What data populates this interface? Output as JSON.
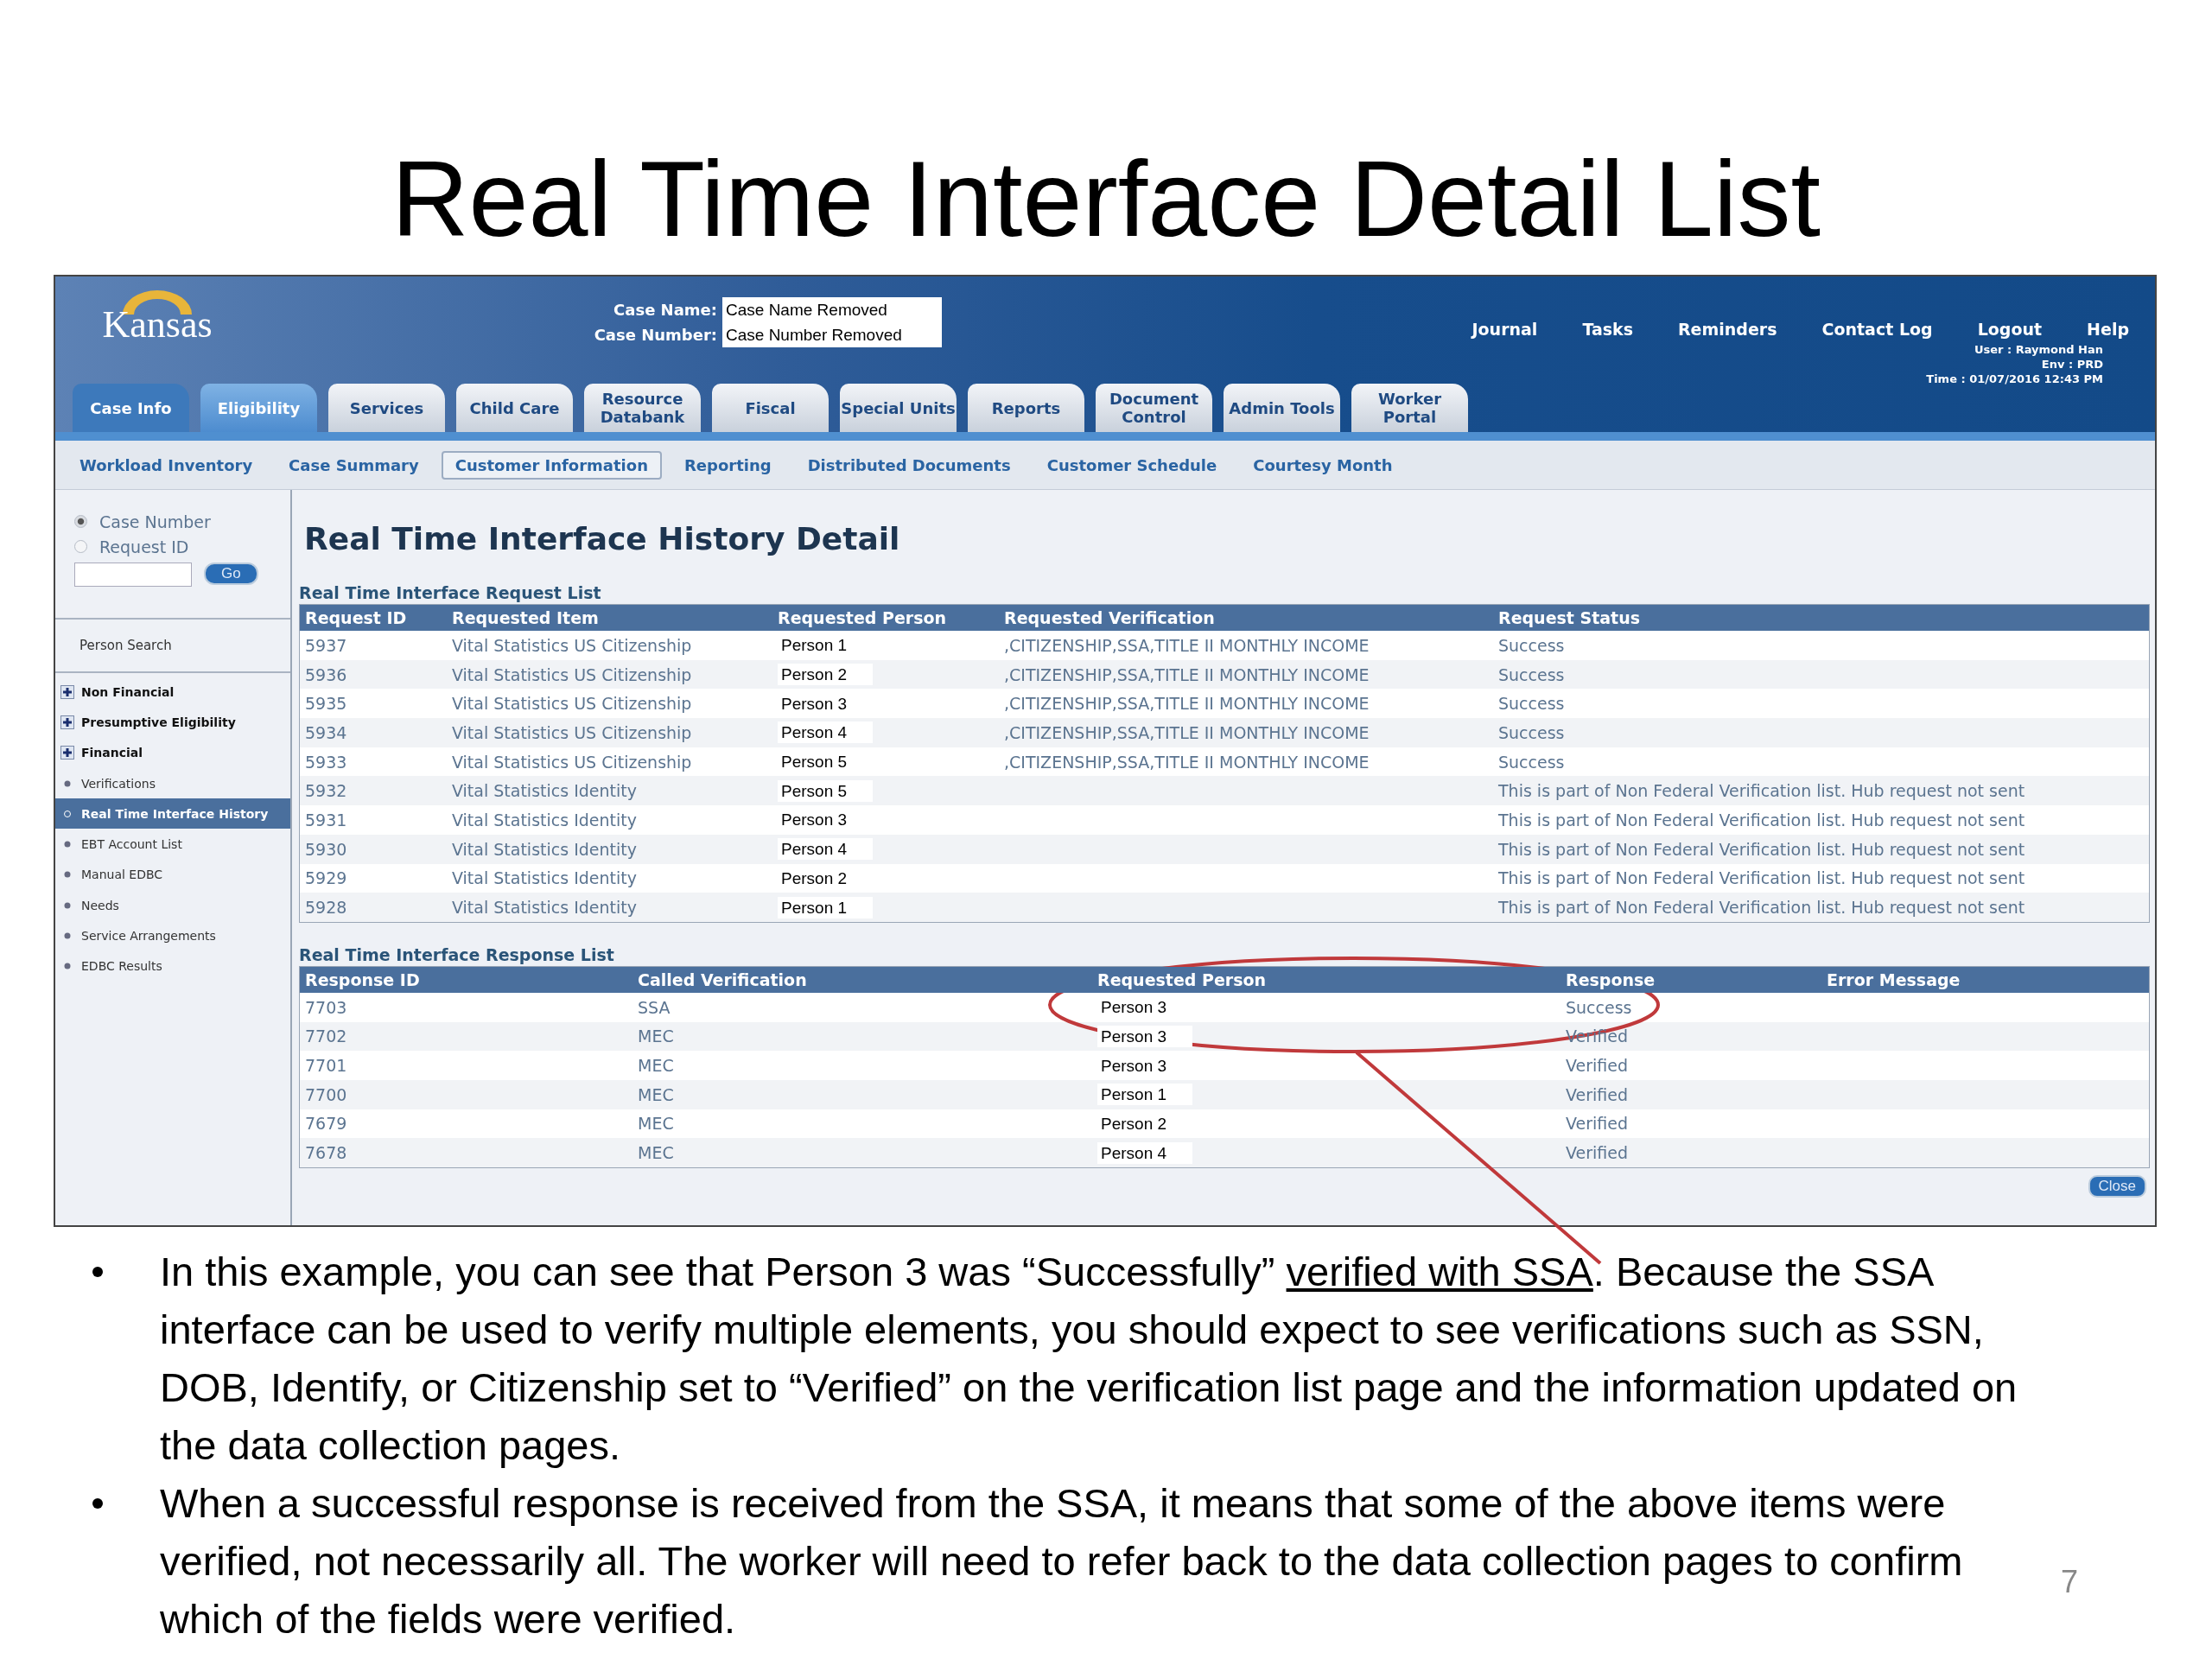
{
  "slide_title": "Real Time Interface Detail List",
  "app": {
    "logo": "Kansas",
    "case_fields": [
      {
        "label": "Case Name:",
        "value": "Case Name Removed"
      },
      {
        "label": "Case Number:",
        "value": "Case Number Removed"
      }
    ],
    "top_links": [
      "Journal",
      "Tasks",
      "Reminders",
      "Contact Log",
      "Logout",
      "Help"
    ],
    "user_info": [
      "User : Raymond Han",
      "Env : PRD",
      "Time : 01/07/2016 12:43 PM"
    ],
    "tabs": [
      {
        "label": "Case Info",
        "selected": true
      },
      {
        "label": "Eligibility",
        "selected": true
      },
      {
        "label": "Services",
        "selected": false
      },
      {
        "label": "Child Care",
        "selected": false
      },
      {
        "label": "Resource Databank",
        "selected": false
      },
      {
        "label": "Fiscal",
        "selected": false
      },
      {
        "label": "Special Units",
        "selected": false
      },
      {
        "label": "Reports",
        "selected": false
      },
      {
        "label": "Document Control",
        "selected": false
      },
      {
        "label": "Admin Tools",
        "selected": false
      },
      {
        "label": "Worker Portal",
        "selected": false
      }
    ],
    "sub_nav": [
      {
        "label": "Workload Inventory",
        "selected": false
      },
      {
        "label": "Case Summary",
        "selected": false
      },
      {
        "label": "Customer Information",
        "selected": true
      },
      {
        "label": "Reporting",
        "selected": false
      },
      {
        "label": "Distributed Documents",
        "selected": false
      },
      {
        "label": "Customer Schedule",
        "selected": false
      },
      {
        "label": "Courtesy Month",
        "selected": false
      }
    ],
    "sidebar": {
      "radios": [
        {
          "label": "Case Number",
          "selected": true
        },
        {
          "label": "Request ID",
          "selected": false
        }
      ],
      "go_button": "Go",
      "person_search": "Person Search",
      "items": [
        {
          "label": "Non Financial",
          "kind": "group",
          "selected": false
        },
        {
          "label": "Presumptive Eligibility",
          "kind": "group",
          "selected": false
        },
        {
          "label": "Financial",
          "kind": "group",
          "selected": false
        },
        {
          "label": "Verifications",
          "kind": "link",
          "selected": false
        },
        {
          "label": "Real Time Interface History",
          "kind": "link",
          "selected": true
        },
        {
          "label": "EBT Account List",
          "kind": "link",
          "selected": false
        },
        {
          "label": "Manual EDBC",
          "kind": "link",
          "selected": false
        },
        {
          "label": "Needs",
          "kind": "link",
          "selected": false
        },
        {
          "label": "Service Arrangements",
          "kind": "link",
          "selected": false
        },
        {
          "label": "EDBC Results",
          "kind": "link",
          "selected": false
        }
      ]
    },
    "page_title": "Real Time Interface History Detail",
    "request_list": {
      "title": "Real Time Interface Request List",
      "columns": [
        "Request ID",
        "Requested Item",
        "Requested Person",
        "Requested Verification",
        "Request Status"
      ],
      "rows": [
        [
          "5937",
          "Vital Statistics US Citizenship",
          "Person 1",
          ",CITIZENSHIP,SSA,TITLE II MONTHLY INCOME",
          "Success"
        ],
        [
          "5936",
          "Vital Statistics US Citizenship",
          "Person 2",
          ",CITIZENSHIP,SSA,TITLE II MONTHLY INCOME",
          "Success"
        ],
        [
          "5935",
          "Vital Statistics US Citizenship",
          "Person 3",
          ",CITIZENSHIP,SSA,TITLE II MONTHLY INCOME",
          "Success"
        ],
        [
          "5934",
          "Vital Statistics US Citizenship",
          "Person 4",
          ",CITIZENSHIP,SSA,TITLE II MONTHLY INCOME",
          "Success"
        ],
        [
          "5933",
          "Vital Statistics US Citizenship",
          "Person 5",
          ",CITIZENSHIP,SSA,TITLE II MONTHLY INCOME",
          "Success"
        ],
        [
          "5932",
          "Vital Statistics Identity",
          "Person 5",
          "",
          "This is part of Non Federal Verification list. Hub request not sent"
        ],
        [
          "5931",
          "Vital Statistics Identity",
          "Person 3",
          "",
          "This is part of Non Federal Verification list. Hub request not sent"
        ],
        [
          "5930",
          "Vital Statistics Identity",
          "Person 4",
          "",
          "This is part of Non Federal Verification list. Hub request not sent"
        ],
        [
          "5929",
          "Vital Statistics Identity",
          "Person 2",
          "",
          "This is part of Non Federal Verification list. Hub request not sent"
        ],
        [
          "5928",
          "Vital Statistics Identity",
          "Person 1",
          "",
          "This is part of Non Federal Verification list. Hub request not sent"
        ]
      ]
    },
    "response_list": {
      "title": "Real Time Interface Response List",
      "columns": [
        "Response ID",
        "Called Verification",
        "Requested Person",
        "Response",
        "Error Message"
      ],
      "rows": [
        [
          "7703",
          "SSA",
          "Person 3",
          "Success",
          ""
        ],
        [
          "7702",
          "MEC",
          "Person 3",
          "Verified",
          ""
        ],
        [
          "7701",
          "MEC",
          "Person 3",
          "Verified",
          ""
        ],
        [
          "7700",
          "MEC",
          "Person 1",
          "Verified",
          ""
        ],
        [
          "7679",
          "MEC",
          "Person 2",
          "Verified",
          ""
        ],
        [
          "7678",
          "MEC",
          "Person 4",
          "Verified",
          ""
        ]
      ]
    },
    "close_button": "Close"
  },
  "bullets": [
    {
      "parts": [
        {
          "text": "In this example, you can see that Person 3 was “Successfully” ",
          "underline": false
        },
        {
          "text": "verified with SSA",
          "underline": true
        },
        {
          "text": ". Because the SSA interface can be used to verify multiple elements, you should expect to see verifications such as SSN, DOB, Identify, or Citizenship set to “Verified” on the verification list page and the information updated on the data collection pages.",
          "underline": false
        }
      ]
    },
    {
      "parts": [
        {
          "text": "When a successful response is received from the SSA, it means that some of the above items were verified, not necessarily all. The worker will need to refer back to the data collection pages to confirm which of the fields were verified.",
          "underline": false
        }
      ]
    }
  ],
  "page_number": "7"
}
